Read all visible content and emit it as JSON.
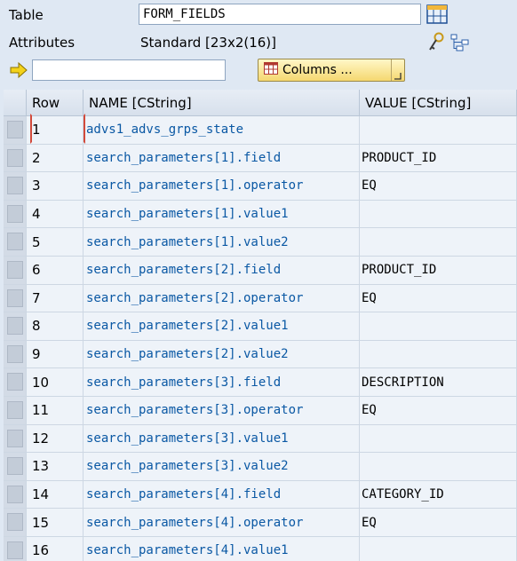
{
  "header": {
    "table_label": "Table",
    "table_value": "FORM_FIELDS",
    "attributes_label": "Attributes",
    "attributes_value": "Standard [23x2(16)]",
    "columns_button": "Columns ...",
    "top_input_value": ""
  },
  "columns": {
    "row": "Row",
    "name": "NAME [CString]",
    "value": "VALUE [CString]"
  },
  "rows": [
    {
      "row": "1",
      "name": "advs1_advs_grps_state",
      "value": ""
    },
    {
      "row": "2",
      "name": "search_parameters[1].field",
      "value": "PRODUCT_ID"
    },
    {
      "row": "3",
      "name": "search_parameters[1].operator",
      "value": "EQ"
    },
    {
      "row": "4",
      "name": "search_parameters[1].value1",
      "value": ""
    },
    {
      "row": "5",
      "name": "search_parameters[1].value2",
      "value": ""
    },
    {
      "row": "6",
      "name": "search_parameters[2].field",
      "value": "PRODUCT_ID"
    },
    {
      "row": "7",
      "name": "search_parameters[2].operator",
      "value": "EQ"
    },
    {
      "row": "8",
      "name": "search_parameters[2].value1",
      "value": ""
    },
    {
      "row": "9",
      "name": "search_parameters[2].value2",
      "value": ""
    },
    {
      "row": "10",
      "name": "search_parameters[3].field",
      "value": "DESCRIPTION"
    },
    {
      "row": "11",
      "name": "search_parameters[3].operator",
      "value": "EQ"
    },
    {
      "row": "12",
      "name": "search_parameters[3].value1",
      "value": ""
    },
    {
      "row": "13",
      "name": "search_parameters[3].value2",
      "value": ""
    },
    {
      "row": "14",
      "name": "search_parameters[4].field",
      "value": "CATEGORY_ID"
    },
    {
      "row": "15",
      "name": "search_parameters[4].operator",
      "value": "EQ"
    },
    {
      "row": "16",
      "name": "search_parameters[4].value1",
      "value": ""
    }
  ],
  "icons": {
    "table_view": "table-grid-icon",
    "key": "key-icon",
    "structure": "structure-tree-icon",
    "arrow": "yellow-arrow-icon",
    "columns": "columns-grid-icon"
  },
  "colors": {
    "link_text": "#0a58a4",
    "background": "#dfe8f3"
  }
}
